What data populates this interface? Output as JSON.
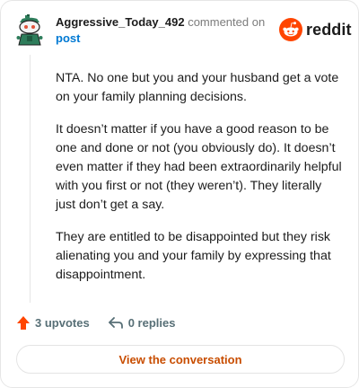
{
  "header": {
    "username": "Aggressive_Today_492",
    "action_text": "commented on",
    "target": "post",
    "brand": "reddit"
  },
  "comment": {
    "paragraphs": [
      "NTA. No one but you and your husband get a vote on your family planning decisions.",
      "It doesn’t matter if you have a good reason to be one and done or not (you obviously do). It doesn’t even matter if they had been extraordinarily helpful with you first or not (they weren’t). They literally just don’t get a say.",
      "They are entitled to be disappointed but they risk alienating you and your family by expressing that disappointment."
    ]
  },
  "footer": {
    "upvotes": "3 upvotes",
    "replies": "0 replies",
    "cta": "View the conversation"
  },
  "icons": {
    "avatar": "snoo-avatar-icon",
    "brand": "reddit-snoo-icon",
    "upvote": "upvote-arrow-icon",
    "reply": "reply-arrow-icon"
  },
  "colors": {
    "brand_orange": "#ff4500",
    "cta_text": "#c84d00",
    "link_blue": "#0079d3",
    "muted": "#576f76"
  }
}
